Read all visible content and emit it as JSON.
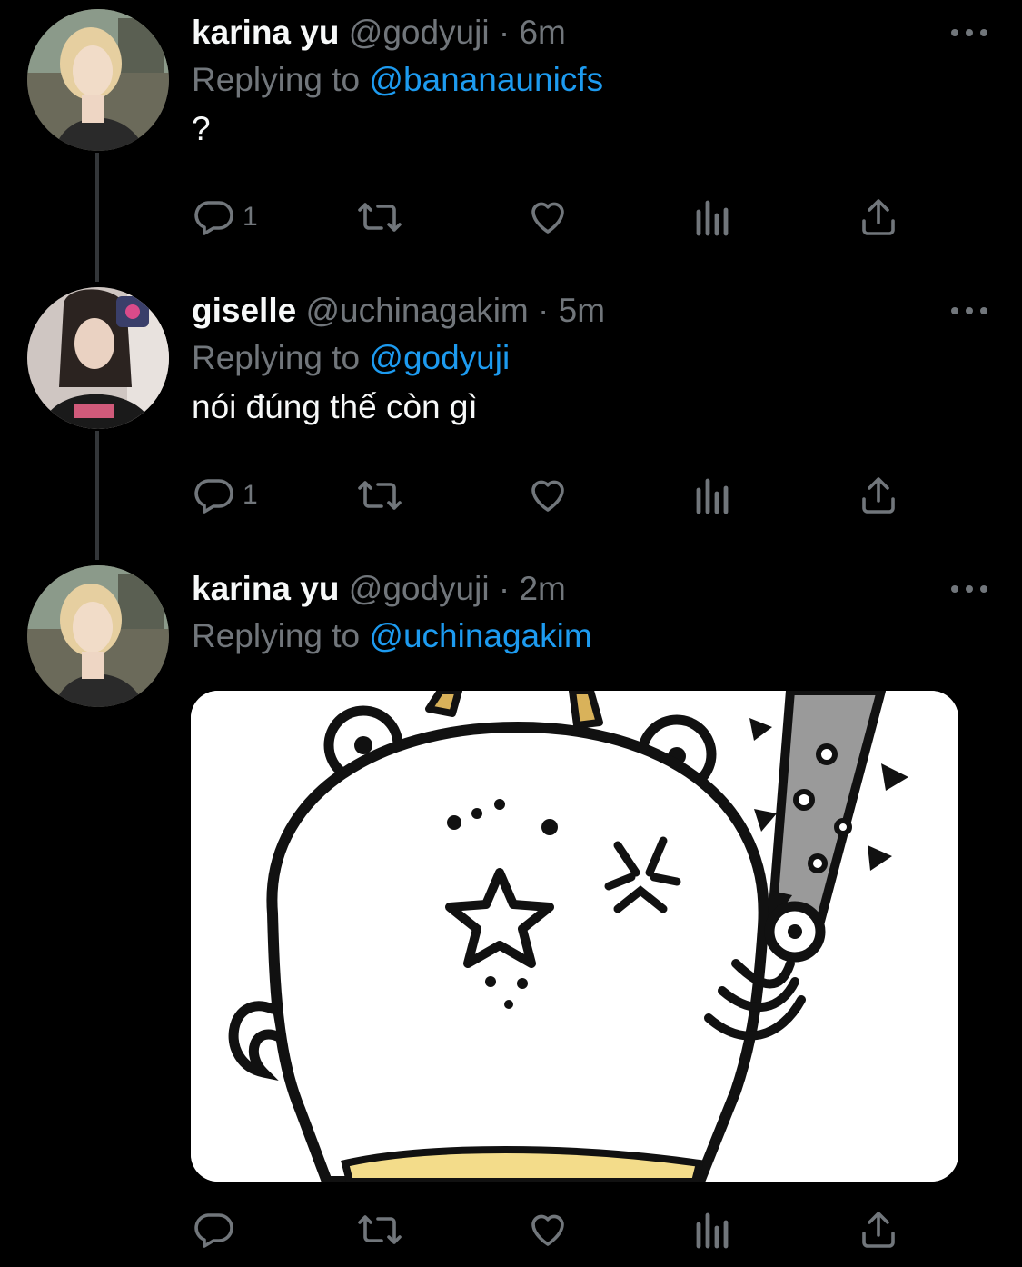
{
  "tweets": [
    {
      "name": "karina yu",
      "handle": "@godyuji",
      "separator": "·",
      "time": "6m",
      "reply_prefix": "Replying to",
      "reply_target": "@bananaunicfs",
      "text": "?",
      "reply_count": "1"
    },
    {
      "name": "giselle",
      "handle": "@uchinagakim",
      "separator": "·",
      "time": "5m",
      "reply_prefix": "Replying to",
      "reply_target": "@godyuji",
      "text": "nói đúng thế còn gì",
      "reply_count": "1"
    },
    {
      "name": "karina yu",
      "handle": "@godyuji",
      "separator": "·",
      "time": "2m",
      "reply_prefix": "Replying to",
      "reply_target": "@uchinagakim",
      "text": "",
      "reply_count": ""
    }
  ],
  "icons": [
    "reply-icon",
    "retweet-icon",
    "like-icon",
    "analytics-icon",
    "share-icon",
    "more-icon"
  ],
  "colors": {
    "background": "#000000",
    "muted": "#71767b",
    "link": "#1d9bf0",
    "text": "#f7f9f9"
  }
}
